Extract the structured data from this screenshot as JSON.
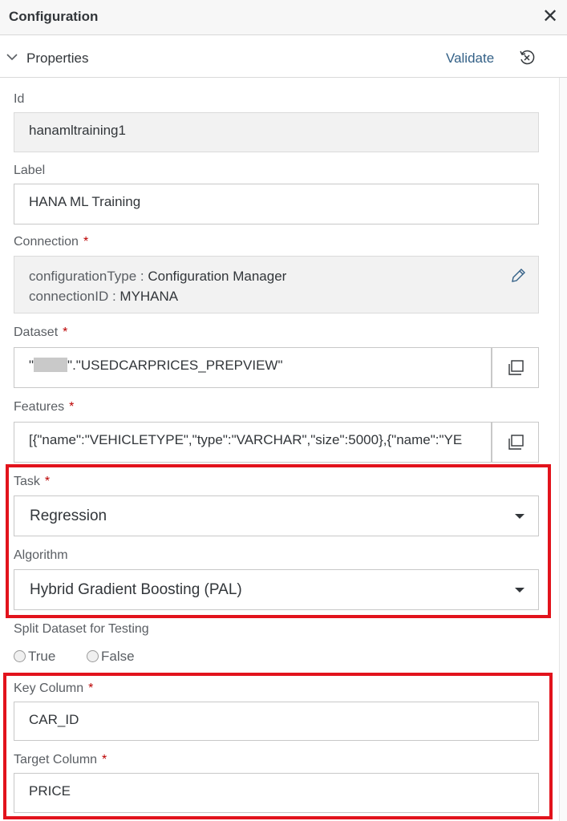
{
  "header": {
    "title": "Configuration",
    "close_icon": "close-icon"
  },
  "section": {
    "title": "Properties",
    "validate_label": "Validate",
    "collapse_icon": "chevron-down-icon",
    "reset_icon": "reset-icon"
  },
  "fields": {
    "id": {
      "label": "Id",
      "value": "hanamltraining1"
    },
    "label": {
      "label": "Label",
      "value": "HANA ML Training"
    },
    "connection": {
      "label": "Connection",
      "required": "*",
      "type_key": "configurationType",
      "type_value": "Configuration Manager",
      "id_key": "connectionID",
      "id_value": "MYHANA",
      "separator": " : "
    },
    "dataset": {
      "label": "Dataset",
      "required": "*",
      "value_prefix": "\"",
      "value_suffix": "\".\"USEDCARPRICES_PREPVIEW\""
    },
    "features": {
      "label": "Features",
      "required": "*",
      "value": "[{\"name\":\"VEHICLETYPE\",\"type\":\"VARCHAR\",\"size\":5000},{\"name\":\"YE"
    },
    "task": {
      "label": "Task",
      "required": "*",
      "value": "Regression"
    },
    "algorithm": {
      "label": "Algorithm",
      "value": "Hybrid Gradient Boosting (PAL)"
    },
    "split": {
      "label": "Split Dataset for Testing",
      "options": [
        "True",
        "False"
      ]
    },
    "key_column": {
      "label": "Key Column",
      "required": "*",
      "value": "CAR_ID"
    },
    "target_column": {
      "label": "Target Column",
      "required": "*",
      "value": "PRICE"
    }
  },
  "colors": {
    "highlight": "#e2131c",
    "link": "#346187",
    "required": "#bb0000"
  }
}
